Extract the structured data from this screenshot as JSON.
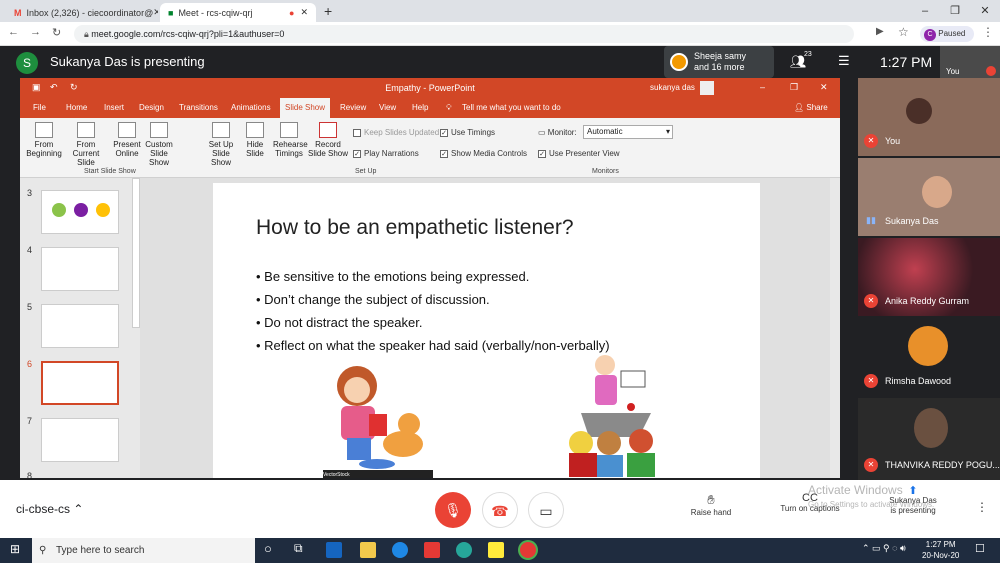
{
  "browser": {
    "tabs": [
      {
        "label": "Inbox (2,326) - ciecoordinator@"
      },
      {
        "label": "Meet - rcs-cqiw-qrj"
      }
    ],
    "url": "meet.google.com/rcs-cqiw-qrj?pli=1&authuser=0",
    "profile_label": "Paused",
    "profile_initial": "C"
  },
  "meet": {
    "presenter_initial": "S",
    "presenting_text": "Sukanya Das is presenting",
    "others_line1": "Sheeja samy",
    "others_line2": "and 16 more",
    "participant_count": "23",
    "clock": "1:27 PM",
    "self_label": "You",
    "meeting_code": "ci-cbse-cs",
    "raise_hand": "Raise hand",
    "captions": "Turn on captions",
    "presenting_line1": "Sukanya Das",
    "presenting_line2": "is presenting",
    "activate_line1": "Activate Windows",
    "activate_line2": "Go to Settings to activate Windows."
  },
  "participants": [
    {
      "name": "You",
      "bg": "#8a6a5a"
    },
    {
      "name": "Sukanya Das",
      "bg": "#9a7e70"
    },
    {
      "name": "Anika Reddy Gurram",
      "bg": "#3a1a22"
    },
    {
      "name": "Rimsha Dawood",
      "bg": "#202124"
    },
    {
      "name": "THANVIKA REDDY POGU...",
      "bg": "#2a2a2a"
    }
  ],
  "powerpoint": {
    "title": "Empathy  -  PowerPoint",
    "user": "sukanya das",
    "menu": [
      "File",
      "Home",
      "Insert",
      "Design",
      "Transitions",
      "Animations",
      "Slide Show",
      "Review",
      "View",
      "Help"
    ],
    "tell_me": "Tell me what you want to do",
    "share": "Share",
    "ribbon": {
      "from_beginning": "From Beginning",
      "from_current": "From Current Slide",
      "present_online": "Present Online",
      "custom_show": "Custom Slide Show",
      "group1": "Start Slide Show",
      "setup_show": "Set Up Slide Show",
      "hide_slide": "Hide Slide",
      "rehearse": "Rehearse Timings",
      "record": "Record Slide Show",
      "keep_updated": "Keep Slides Updated",
      "play_narrations": "Play Narrations",
      "use_timings": "Use Timings",
      "show_media": "Show Media Controls",
      "group2": "Set Up",
      "monitor_label": "Monitor:",
      "monitor_value": "Automatic",
      "presenter_view": "Use Presenter View",
      "group3": "Monitors"
    },
    "thumb_numbers": [
      "3",
      "4",
      "5",
      "6",
      "7",
      "8"
    ],
    "slide": {
      "title": "How to be an empathetic listener?",
      "bullets": [
        "Be sensitive to the emotions being expressed.",
        "Don’t change the subject of discussion.",
        "Do not distract the speaker.",
        "Reflect on what the speaker had said (verbally/non-verbally)"
      ],
      "image_caption": "VectorStock"
    }
  },
  "taskbar": {
    "search_placeholder": "Type here to search",
    "time": "1:27 PM",
    "date": "20-Nov-20"
  }
}
